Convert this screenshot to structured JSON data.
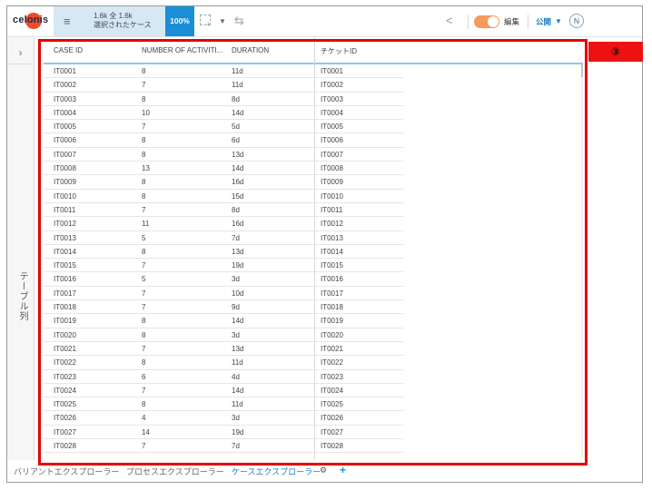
{
  "header": {
    "logo_text": "celonis",
    "counts_line1": "1.6k 全 1.6k",
    "counts_line2": "選択されたケース",
    "percent": "100%",
    "edit_label": "編集",
    "publish_label": "公開",
    "avatar_initial": "N"
  },
  "rail": {
    "label": "テーブル列"
  },
  "table": {
    "columns": [
      "CASE ID",
      "NUMBER OF ACTIVITI...",
      "DURATION",
      "チケットID"
    ],
    "rows": [
      [
        "IT0001",
        "8",
        "11d",
        "IT0001"
      ],
      [
        "IT0002",
        "7",
        "11d",
        "IT0002"
      ],
      [
        "IT0003",
        "8",
        "8d",
        "IT0003"
      ],
      [
        "IT0004",
        "10",
        "14d",
        "IT0004"
      ],
      [
        "IT0005",
        "7",
        "5d",
        "IT0005"
      ],
      [
        "IT0006",
        "8",
        "6d",
        "IT0006"
      ],
      [
        "IT0007",
        "8",
        "13d",
        "IT0007"
      ],
      [
        "IT0008",
        "13",
        "14d",
        "IT0008"
      ],
      [
        "IT0009",
        "8",
        "16d",
        "IT0009"
      ],
      [
        "IT0010",
        "8",
        "15d",
        "IT0010"
      ],
      [
        "IT0011",
        "7",
        "8d",
        "IT0011"
      ],
      [
        "IT0012",
        "11",
        "16d",
        "IT0012"
      ],
      [
        "IT0013",
        "5",
        "7d",
        "IT0013"
      ],
      [
        "IT0014",
        "8",
        "13d",
        "IT0014"
      ],
      [
        "IT0015",
        "7",
        "19d",
        "IT0015"
      ],
      [
        "IT0016",
        "5",
        "3d",
        "IT0016"
      ],
      [
        "IT0017",
        "7",
        "10d",
        "IT0017"
      ],
      [
        "IT0018",
        "7",
        "9d",
        "IT0018"
      ],
      [
        "IT0019",
        "8",
        "14d",
        "IT0019"
      ],
      [
        "IT0020",
        "8",
        "3d",
        "IT0020"
      ],
      [
        "IT0021",
        "7",
        "13d",
        "IT0021"
      ],
      [
        "IT0022",
        "8",
        "11d",
        "IT0022"
      ],
      [
        "IT0023",
        "6",
        "4d",
        "IT0023"
      ],
      [
        "IT0024",
        "7",
        "14d",
        "IT0024"
      ],
      [
        "IT0025",
        "8",
        "11d",
        "IT0025"
      ],
      [
        "IT0026",
        "4",
        "3d",
        "IT0026"
      ],
      [
        "IT0027",
        "14",
        "19d",
        "IT0027"
      ],
      [
        "IT0028",
        "7",
        "7d",
        "IT0028"
      ]
    ]
  },
  "marker_label": "③",
  "tabs": {
    "items": [
      "バリアントエクスプローラー",
      "プロセスエクスプローラー",
      "ケースエクスプローラー"
    ],
    "active_index": 2
  },
  "icons": {
    "menu": "menu-icon",
    "selection": "selection-icon",
    "swap": "swap-icon",
    "share": "share-icon",
    "gear": "gear-icon",
    "add": "plus-icon",
    "expand": "chevron-right-icon"
  },
  "colors": {
    "accent": "#1a8fd6",
    "filter_bg": "#d6e8f3",
    "toggle": "#f59a5a",
    "highlight": "#e60000",
    "logo_dot": "#f04a2a",
    "header_underline": "#8ecae6"
  }
}
